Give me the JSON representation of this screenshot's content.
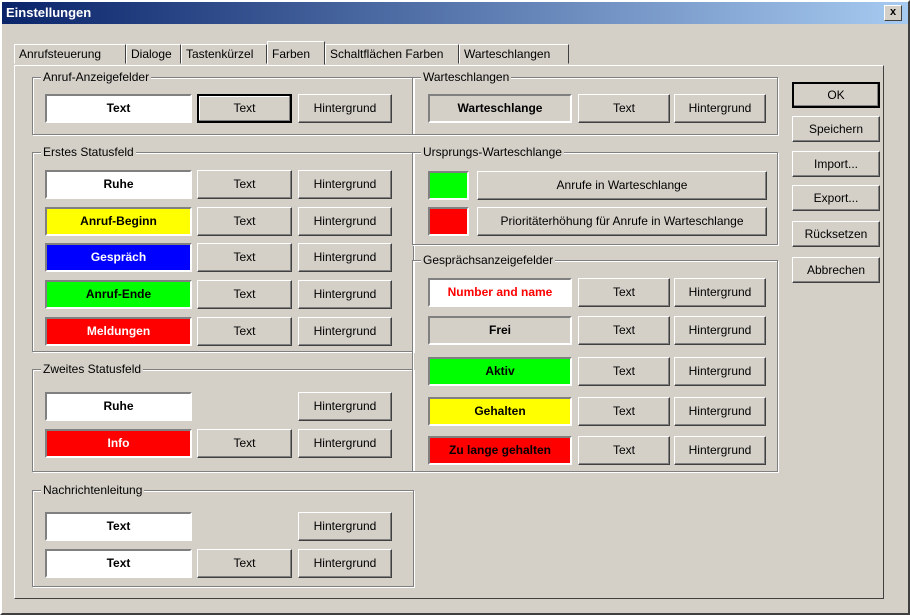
{
  "window": {
    "title": "Einstellungen",
    "close_label": "x"
  },
  "tabs": [
    "Anrufsteuerung",
    "Dialoge",
    "Tastenkürzel",
    "Farben",
    "Schaltflächen Farben",
    "Warteschlangen"
  ],
  "common": {
    "text_btn": "Text",
    "bg_btn": "Hintergrund"
  },
  "anruf_anzeige": {
    "title": "Anruf-Anzeigefelder",
    "swatch": "Text"
  },
  "erstes": {
    "title": "Erstes Statusfeld",
    "items": [
      {
        "label": "Ruhe",
        "bg": "#ffffff",
        "fg": "#000000"
      },
      {
        "label": "Anruf-Beginn",
        "bg": "#ffff00",
        "fg": "#000000"
      },
      {
        "label": "Gespräch",
        "bg": "#0000ff",
        "fg": "#ffffff"
      },
      {
        "label": "Anruf-Ende",
        "bg": "#00ff00",
        "fg": "#000000"
      },
      {
        "label": "Meldungen",
        "bg": "#ff0000",
        "fg": "#ffffff"
      }
    ]
  },
  "zweites": {
    "title": "Zweites Statusfeld",
    "items": [
      {
        "label": "Ruhe",
        "bg": "#ffffff",
        "fg": "#000000"
      },
      {
        "label": "Info",
        "bg": "#ff0000",
        "fg": "#ffffff"
      }
    ]
  },
  "nachrichten": {
    "title": "Nachrichtenleitung",
    "items": [
      {
        "label": "Text",
        "bg": "#ffffff",
        "fg": "#000000"
      },
      {
        "label": "Text",
        "bg": "#ffffff",
        "fg": "#000000"
      }
    ]
  },
  "warteschlangen": {
    "title": "Warteschlangen",
    "swatch": "Warteschlange"
  },
  "ursprung": {
    "title": "Ursprungs-Warteschlange",
    "rows": [
      {
        "color": "#00ff00",
        "label": "Anrufe in Warteschlange"
      },
      {
        "color": "#ff0000",
        "label": "Prioritäterhöhung für Anrufe in Warteschlange"
      }
    ]
  },
  "gespraech": {
    "title": "Gesprächsanzeigefelder",
    "items": [
      {
        "label": "Number and name",
        "bg": "#ffffff",
        "fg": "#ff0000"
      },
      {
        "label": "Frei",
        "bg": "#d4d0c8",
        "fg": "#000000"
      },
      {
        "label": "Aktiv",
        "bg": "#00ff00",
        "fg": "#000000"
      },
      {
        "label": "Gehalten",
        "bg": "#ffff00",
        "fg": "#000000"
      },
      {
        "label": "Zu lange gehalten",
        "bg": "#ff0000",
        "fg": "#000000"
      }
    ]
  },
  "side_buttons": [
    "OK",
    "Speichern",
    "Import...",
    "Export...",
    "Rücksetzen",
    "Abbrechen"
  ]
}
